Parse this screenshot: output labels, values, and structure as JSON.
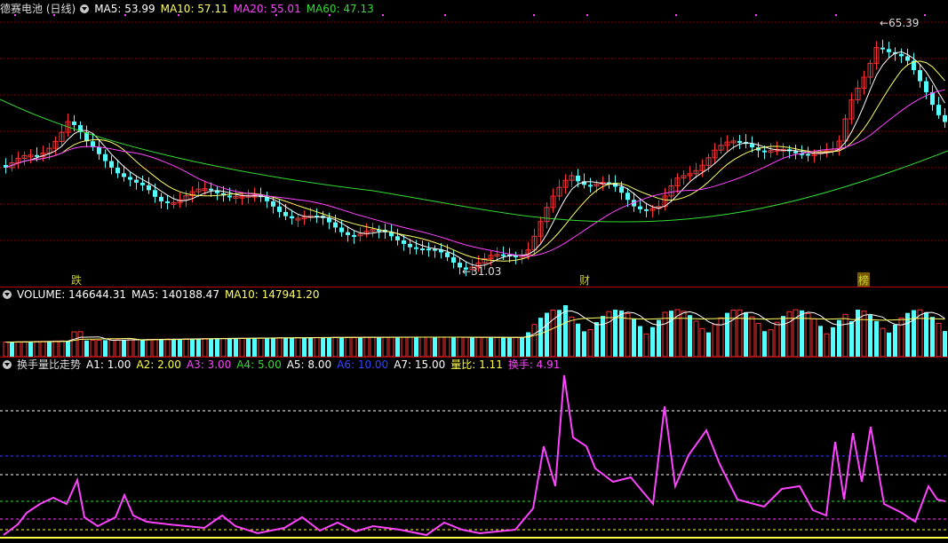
{
  "kline": {
    "title": "德赛电池 (日线)",
    "indicators": [
      {
        "label": "MA5: 53.99",
        "color": "#ffffff"
      },
      {
        "label": "MA10: 57.11",
        "color": "#ffff66"
      },
      {
        "label": "MA20: 55.01",
        "color": "#ff44ff"
      },
      {
        "label": "MA60: 47.13",
        "color": "#33dd33"
      }
    ],
    "high_label": "65.39",
    "low_label": "31.03",
    "markers": [
      {
        "text": "跌",
        "color": "#cccc33"
      },
      {
        "text": "财",
        "color": "#cccc33"
      },
      {
        "text": "榜",
        "color": "#cccc33"
      }
    ]
  },
  "volume": {
    "indicators": [
      {
        "label": "VOLUME: 146644.31",
        "color": "#ffffff"
      },
      {
        "label": "MA5: 140188.47",
        "color": "#ffffff"
      },
      {
        "label": "MA10: 147941.20",
        "color": "#ffff66"
      }
    ]
  },
  "turnover": {
    "title": "换手量比走势",
    "indicators": [
      {
        "label": "A1: 1.00",
        "color": "#ffffff"
      },
      {
        "label": "A2: 2.00",
        "color": "#ffff44"
      },
      {
        "label": "A3: 3.00",
        "color": "#ff44ff"
      },
      {
        "label": "A4: 5.00",
        "color": "#33dd33"
      },
      {
        "label": "A5: 8.00",
        "color": "#ffffff"
      },
      {
        "label": "A6: 10.00",
        "color": "#3344ff"
      },
      {
        "label": "A7: 15.00",
        "color": "#ffffff"
      },
      {
        "label": "量比: 1.11",
        "color": "#ffff44"
      },
      {
        "label": "换手: 4.91",
        "color": "#ff44ff"
      }
    ]
  },
  "colors": {
    "up": "#ff3333",
    "down": "#54ffff",
    "grid": "#a00000",
    "ma5": "#ffffff",
    "ma10": "#ffff66",
    "ma20": "#ff44ff",
    "ma60": "#33dd33"
  }
}
